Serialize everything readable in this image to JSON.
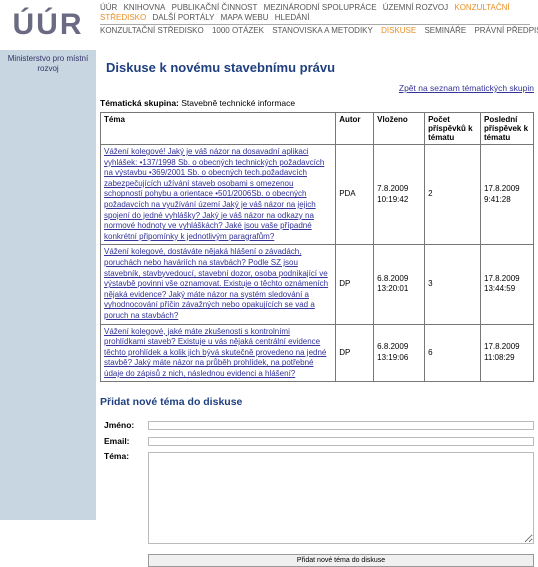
{
  "header": {
    "logo": "ÚÚR",
    "nav_top": [
      {
        "label": "ÚÚR",
        "active": false
      },
      {
        "label": "Knihovna",
        "active": false
      },
      {
        "label": "Publikační činnost",
        "active": false
      },
      {
        "label": "Mezinárodní spolupráce",
        "active": false
      },
      {
        "label": "Územní rozvoj",
        "active": false
      },
      {
        "label": "Konzultační středisko",
        "active": true
      },
      {
        "label": "Další portály",
        "active": false
      },
      {
        "label": "Mapa webu",
        "active": false
      },
      {
        "label": "Hledání",
        "active": false
      }
    ],
    "nav_sub": [
      {
        "label": "Konzultační středisko",
        "active": false
      },
      {
        "label": "1000 otázek",
        "active": false
      },
      {
        "label": "Stanoviska a metodiky",
        "active": false
      },
      {
        "label": "Diskuse",
        "active": true
      },
      {
        "label": "Semináře",
        "active": false
      },
      {
        "label": "Právní předpisy",
        "active": false
      }
    ]
  },
  "sidebar": {
    "items": [
      {
        "label": "Ministerstvo pro místní rozvoj"
      }
    ]
  },
  "main": {
    "title": "Diskuse k novému stavebnímu právu",
    "back_link": "Zpět na seznam tématických skupin",
    "group_label": "Tématická skupina:",
    "group_value": "Stavebně technické informace",
    "table": {
      "headers": {
        "topic": "Téma",
        "author": "Autor",
        "posted": "Vloženo",
        "count": "Počet příspěvků k tématu",
        "last": "Poslední příspěvek k tématu"
      },
      "rows": [
        {
          "topic": "Vážení kolegové! Jaký je váš názor na dosavadní aplikaci vyhlášek: •137/1998 Sb. o obecných technických požadavcích na výstavbu •369/2001 Sb. o obecných tech.požadavcích zabezpečujících užívání staveb osobami s omezenou schopností pohybu a orientace •501/2006Sb. o obecných požadavcích na využívání území Jaký je váš názor na jejich spojení do jedné vyhlášky? Jaký je váš názor na odkazy na normové hodnoty ve vyhláškách? Jaké jsou vaše případné konkrétní připomínky k jednotlivým paragrafům?",
          "author": "PDA",
          "posted": "7.8.2009 10:19:42",
          "count": "2",
          "last": "17.8.2009 9:41:28"
        },
        {
          "topic": "Vážení kolegové, dostáváte nějaká hlášení o závadách, poruchách nebo haváriích na stavbách? Podle SZ jsou stavebník, stavbyvedoucí, stavební dozor, osoba podnikající ve výstavbě povinni vše oznamovat. Existuje o těchto oznámeních nějaká evidence? Jaký máte názor na systém sledování a vyhodnocování příčin závažných nebo opakujících se vad a poruch na stavbách?",
          "author": "DP",
          "posted": "6.8.2009 13:20:01",
          "count": "3",
          "last": "17.8.2009 13:44:59"
        },
        {
          "topic": "Vážení kolegové, jaké máte zkušenosti s kontrolními prohlídkami staveb? Existuje u vás nějaká centrální evidence těchto prohlídek a kolik jich bývá skutečně provedeno na jedné stavbě? Jaký máte názor na průběh prohlídek, na potřebné údaje do zápisů z nich, následnou evidenci a hlášení?",
          "author": "DP",
          "posted": "6.8.2009 13:19:06",
          "count": "6",
          "last": "17.8.2009 11:08:29"
        }
      ]
    },
    "add_topic": {
      "title": "Přidat nové téma do diskuse",
      "name_label": "Jméno:",
      "email_label": "Email:",
      "topic_label": "Téma:",
      "name_value": "",
      "email_value": "",
      "topic_value": "",
      "submit_label": "Přidat nové téma do diskuse"
    }
  },
  "colors": {
    "accent_orange": "#e89028",
    "title_blue": "#1f3f7f",
    "link": "#333399",
    "sidebar_bg": "#c8d6e2",
    "logo": "#6a6a82"
  }
}
